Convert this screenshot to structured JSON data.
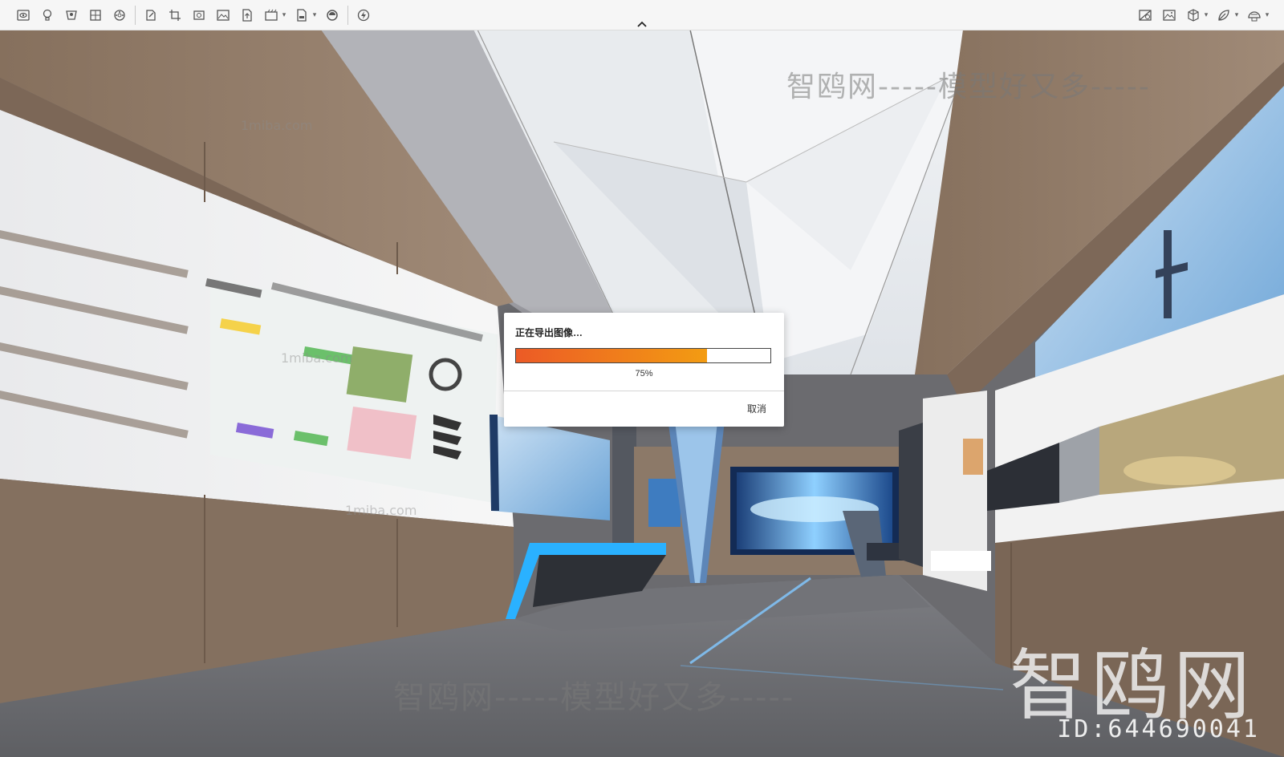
{
  "toolbar": {
    "left_icons": [
      "eye-icon",
      "bulb-icon",
      "camera-icon",
      "grid-icon",
      "film-icon",
      "edit-icon",
      "crop-icon",
      "zoom-icon",
      "image-icon",
      "export-icon",
      "render-icon",
      "file-icon",
      "palette-icon",
      "lightning-icon"
    ],
    "right_icons": [
      "no-image-icon",
      "picture-icon",
      "cube-icon",
      "leaf-icon",
      "dome-icon"
    ]
  },
  "dialog": {
    "title": "正在导出图像…",
    "progress": 0.75,
    "progress_label": "75%",
    "cancel_label": "取消"
  },
  "watermark": {
    "site_text": "智鸥网-----模型好又多-----",
    "bottom_text": "智鸥网-----模型好又多-----",
    "domain_text": "1miba.com",
    "logo_text": "智鸥网",
    "id_text": "ID:644690041"
  },
  "colors": {
    "progress_start": "#ec5a26",
    "progress_end": "#f39c12"
  }
}
